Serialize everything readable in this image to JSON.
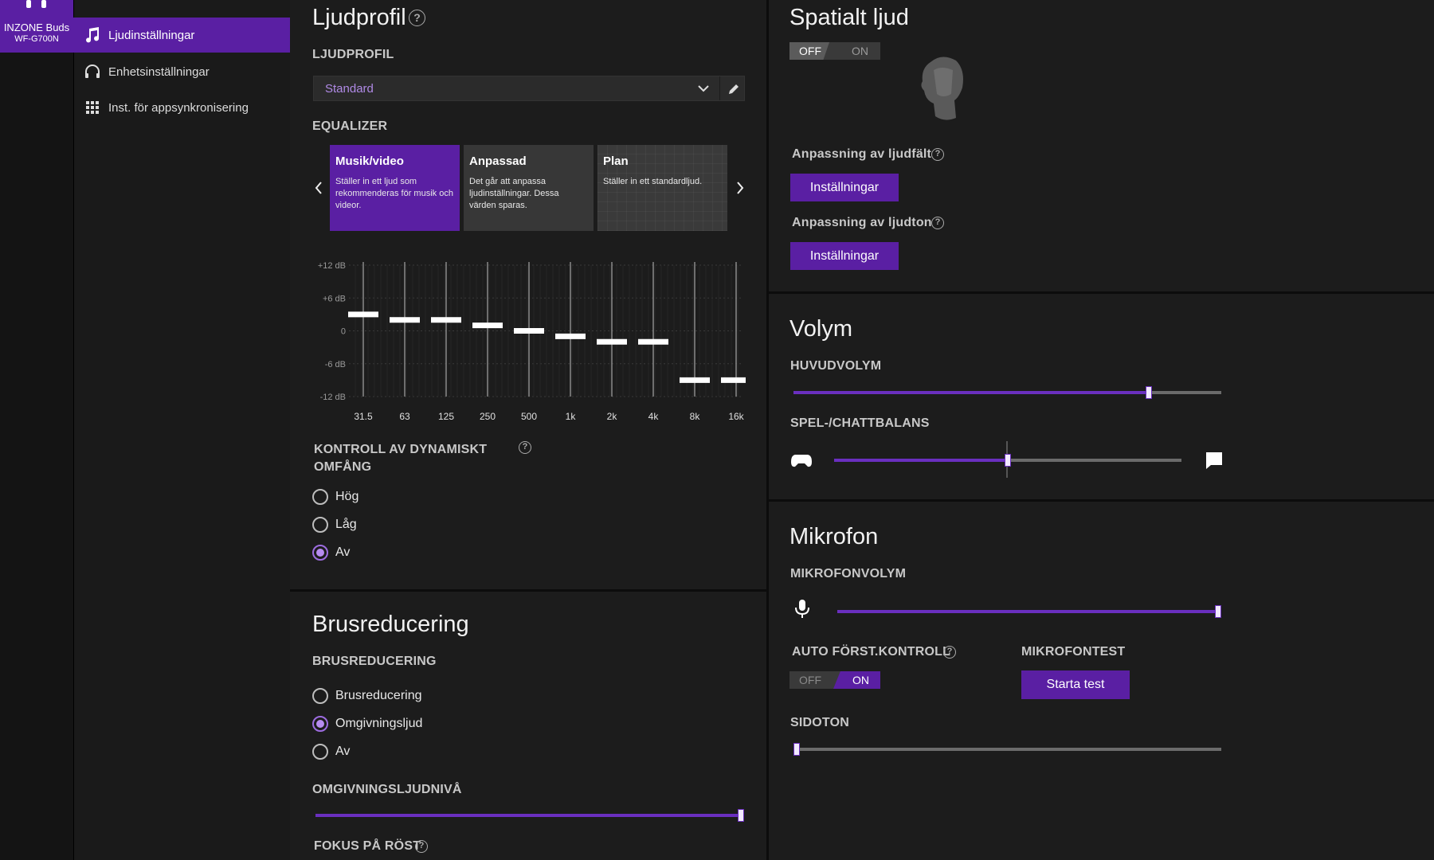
{
  "device": {
    "name": "INZONE Buds",
    "model": "WF-G700N"
  },
  "sidebar": {
    "items": [
      {
        "label": "Ljudinställningar",
        "icon": "music-note-icon",
        "active": true
      },
      {
        "label": "Enhetsinställningar",
        "icon": "headphones-icon",
        "active": false
      },
      {
        "label": "Inst. för appsynkronisering",
        "icon": "grid-icon",
        "active": false
      }
    ]
  },
  "sound_profile": {
    "title": "Ljudprofil",
    "section_label": "LJUDPROFIL",
    "selected": "Standard",
    "equalizer_label": "EQUALIZER",
    "presets": [
      {
        "title": "Musik/video",
        "desc": "Ställer in ett ljud som rekommenderas för musik och videor.",
        "selected": true
      },
      {
        "title": "Anpassad",
        "desc": "Det går att anpassa ljudinställningar. Dessa värden sparas.",
        "selected": false
      },
      {
        "title": "Plan",
        "desc": "Ställer in ett standardljud.",
        "selected": false
      }
    ],
    "eq": {
      "y_labels": [
        "+12 dB",
        "+6 dB",
        "0",
        "-6 dB",
        "-12 dB"
      ],
      "bands": [
        "31.5",
        "63",
        "125",
        "250",
        "500",
        "1k",
        "2k",
        "4k",
        "8k",
        "16k"
      ],
      "gains_db": [
        3,
        2,
        2,
        1,
        0,
        -1,
        -2,
        -2,
        -9,
        -9
      ]
    },
    "drc_label": "KONTROLL AV DYNAMISKT OMFÅNG",
    "drc_options": [
      "Hög",
      "Låg",
      "Av"
    ],
    "drc_selected": "Av"
  },
  "noise": {
    "title": "Brusreducering",
    "section_label": "BRUSREDUCERING",
    "options": [
      "Brusreducering",
      "Omgivningsljud",
      "Av"
    ],
    "selected": "Omgivningsljud",
    "ambient_label": "OMGIVNINGSLJUDNIVÅ",
    "ambient_level": 1.0,
    "voice_focus_label": "FOKUS PÅ RÖST"
  },
  "spatial": {
    "title": "Spatialt ljud",
    "toggle_off": "OFF",
    "toggle_on": "ON",
    "state": "OFF",
    "field_label": "Anpassning av ljudfält",
    "tone_label": "Anpassning av ljudton",
    "settings_button": "Inställningar"
  },
  "volume": {
    "title": "Volym",
    "main_label": "HUVUDVOLYM",
    "main_level": 0.83,
    "balance_label": "SPEL-/CHATTBALANS",
    "balance_level": 0.5
  },
  "mic": {
    "title": "Mikrofon",
    "volume_label": "MIKROFONVOLYM",
    "volume_level": 1.0,
    "agc_label": "AUTO FÖRST.KONTROLL",
    "agc_off": "OFF",
    "agc_on": "ON",
    "agc_state": "ON",
    "test_label": "MIKROFONTEST",
    "test_button": "Starta test",
    "sidetone_label": "SIDOTON",
    "sidetone_level": 0.0
  },
  "help_glyph": "?",
  "colors": {
    "accent": "#5a1fa3",
    "accent_light": "#b78cf0",
    "background": "#1c1c1c"
  }
}
